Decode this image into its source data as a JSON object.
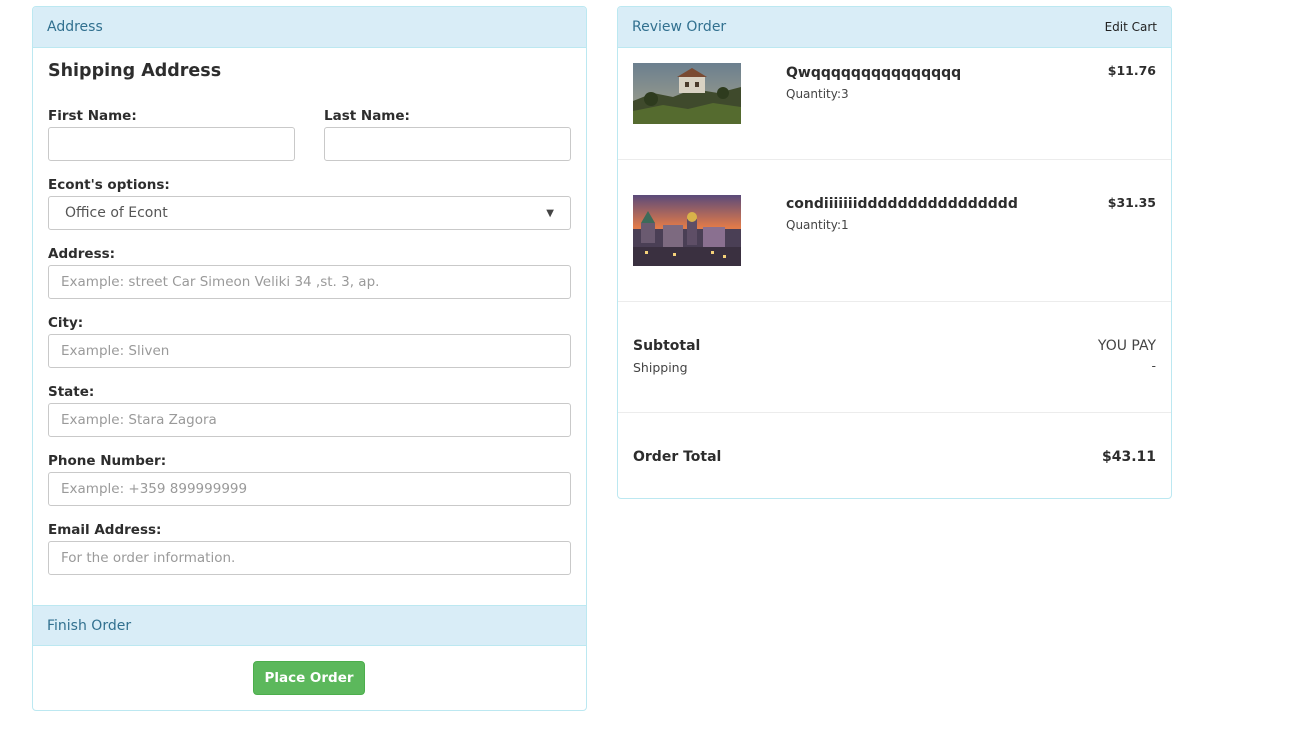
{
  "address_panel": {
    "heading": "Address",
    "shipping_title": "Shipping Address",
    "first_name": {
      "label": "First Name:",
      "value": "",
      "placeholder": ""
    },
    "last_name": {
      "label": "Last Name:",
      "value": "",
      "placeholder": ""
    },
    "econt": {
      "label": "Econt's options:",
      "selected": "Office of Econt"
    },
    "address": {
      "label": "Address:",
      "placeholder": "Example: street Car Simeon Veliki 34 ,st. 3, ap."
    },
    "city": {
      "label": "City:",
      "placeholder": "Example: Sliven"
    },
    "state": {
      "label": "State:",
      "placeholder": "Example: Stara Zagora"
    },
    "phone": {
      "label": "Phone Number:",
      "placeholder": "Example: +359 899999999"
    },
    "email": {
      "label": "Email Address:",
      "placeholder": "For the order information."
    }
  },
  "finish_panel": {
    "heading": "Finish Order",
    "place_order_label": "Place Order",
    "button_color": "#5cb85c"
  },
  "review_panel": {
    "heading": "Review Order",
    "edit_cart_label": "Edit Cart",
    "items": [
      {
        "name": "Qwqqqqqqqqqqqqqqq",
        "quantity": "Quantity:3",
        "price": "$11.76",
        "image": "landscape-photo-cliff-house"
      },
      {
        "name": "condiiiiiiidddddddddddddddd",
        "quantity": "Quantity:1",
        "price": "$31.35",
        "image": "landscape-photo-city-sunset"
      }
    ],
    "subtotal_label": "Subtotal",
    "subtotal_value": "YOU PAY",
    "shipping_label": "Shipping",
    "shipping_value": "-",
    "order_total_label": "Order Total",
    "order_total_value": "$43.11"
  },
  "colors": {
    "panel_heading_bg": "#d9edf7",
    "panel_heading_text": "#31708f",
    "panel_border": "#bce8f1"
  }
}
